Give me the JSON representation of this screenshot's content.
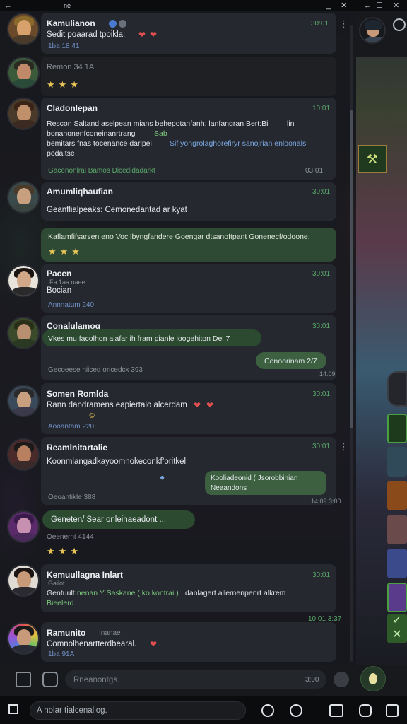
{
  "titlebar": {
    "title": "ne",
    "minimize": "_",
    "close": "✕",
    "back": "←",
    "restore": "☐"
  },
  "messages": [
    {
      "name": "Kamulianon",
      "time": "30:01",
      "text": "Sedit poaarad tpoikla:",
      "sub": "1ba  18 41"
    },
    {
      "name": "",
      "time": "",
      "text": "Remon 34 1A",
      "sub": "",
      "stars": "★★★"
    },
    {
      "name": "Cladonlepan",
      "time": "10:01",
      "line1": "Rescon Saltand  aselpean mians behepotanfanh: lanfangran Bert:Bi",
      "line1_suffix": "lin",
      "line2": "bonanonenfconeinanrtrang",
      "line2_accent": "Sab",
      "line3": "bemitars fnas tocenance daripei",
      "line3_suffix": "Sif yongrolaghorefiryr  sanojrian enloonals",
      "line4": "podaitse",
      "sub": "Gacenonlral Bamos Dicedidadarkt",
      "sub_time": "03:01"
    },
    {
      "name": "Amumliqhaufian",
      "time": "30:01",
      "text": "Geanflialpeaks: Cemonedantad ar kyat"
    },
    {
      "name": "",
      "time": "",
      "text": "Kaflamfifsarsen eno Voc lbyngfandere Goengar dtsanoftpant  Gonenecf/odoone.",
      "stars": "★★★"
    },
    {
      "name": "Pacen",
      "time": "30:01",
      "text": "Bocian",
      "sub": "Annnatum 240",
      "meta": "Fa 1aa naee"
    },
    {
      "name": "Conalulamog",
      "time": "30:01",
      "text": "Vkes mu facolhon alafar ih fram pianle loogehiton  Del 7",
      "reply": "Conoorinam 2/7",
      "sub": "Gecoeese hiiced oricedcx 393",
      "sub_time": "14:09"
    },
    {
      "name": "Somen Romlda",
      "time": "30:01",
      "text": "Rann dandramens eapiertalo alcerdam",
      "sub": "Aooantam 220"
    },
    {
      "name": "Reamlnitartalie",
      "time": "30:01",
      "text": "Koonmlangadkayoomnokeconkf’oritkel",
      "reply_line1": "Kooliadeonid ( Jsorobbinian",
      "reply_line2": "Neaandons",
      "sub": "Oeoantikle 388",
      "sub_time": "14:09  3:00"
    },
    {
      "name": "",
      "time": "",
      "text": "Geneten/ Sear onleihaeadont ...",
      "sub": "Oeenernt 4144",
      "stars": "★★★"
    },
    {
      "name": "Kemuullagna Inlart",
      "time": "30:01",
      "meta": "Gailot",
      "line1": "Gentuult",
      "line1_green": "Inenan Y Saskane ( ko  kontrai )",
      "line1_suffix": "danlagert allernenpenrt alkrem",
      "line2": "Bieelerd.",
      "sub_time": "10:01  3:37"
    },
    {
      "name": "Ramunito",
      "time": "",
      "meta": "Inanae",
      "text": "Comnolbenartterdbearal.",
      "sub": "1ba  91A"
    }
  ],
  "composer": {
    "placeholder": "Rneanontgs.",
    "time": "3:00"
  },
  "bottombar": {
    "search_placeholder": "A nolar tialcenaliog."
  }
}
